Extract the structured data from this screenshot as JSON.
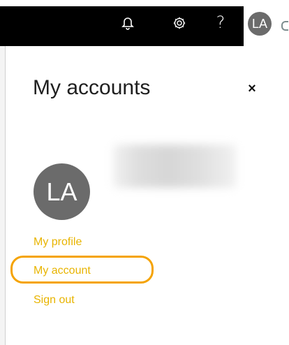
{
  "topbar": {
    "icons": {
      "notifications": "bell-icon",
      "settings": "gear-icon",
      "help": "?"
    },
    "user_initials": "LA"
  },
  "panel": {
    "title": "My accounts",
    "close_label": "×",
    "avatar_initials": "LA",
    "links": {
      "profile": "My profile",
      "account": "My account",
      "signout": "Sign out"
    }
  },
  "colors": {
    "link": "#e8b400",
    "highlight": "#f5a300",
    "avatar_bg": "#6b6b6b",
    "topbar_bg": "#000000"
  }
}
